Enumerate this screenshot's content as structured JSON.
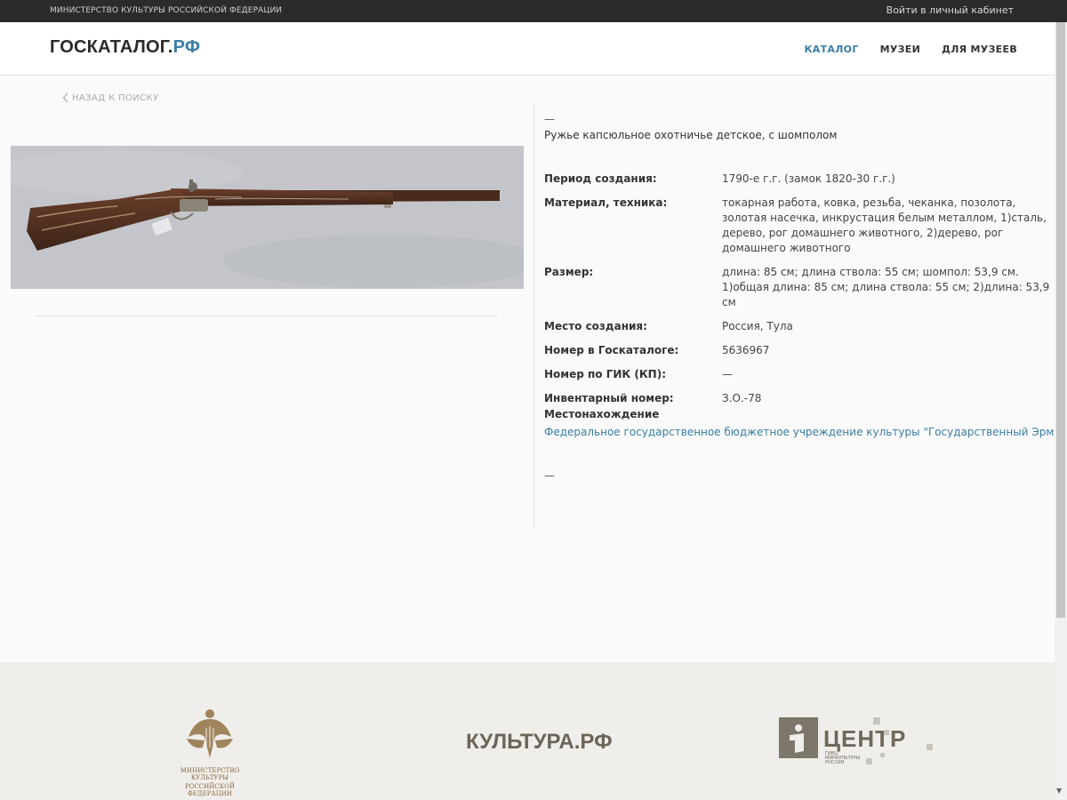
{
  "topbar": {
    "ministry": "МИНИСТЕРСТВО КУЛЬТУРЫ РОССИЙСКОЙ ФЕДЕРАЦИИ",
    "login": "Войти в личный кабинет"
  },
  "header": {
    "logo_main": "ГОСКАТАЛОГ.",
    "logo_accent": "РФ",
    "nav": [
      {
        "label": "КАТАЛОГ",
        "active": true
      },
      {
        "label": "МУЗЕИ",
        "active": false
      },
      {
        "label": "ДЛЯ МУЗЕЕВ",
        "active": false
      }
    ]
  },
  "back_link": "НАЗАД К ПОИСКУ",
  "item": {
    "dash_top": "—",
    "title": "Ружье капсюльное охотничье детское, с шомполом",
    "properties": [
      {
        "label": "Период создания:",
        "value": "1790-е г.г. (замок 1820-30 г.г.)"
      },
      {
        "label": "Материал, техника:",
        "value": "токарная работа, ковка, резьба, чеканка, позолота, золотая насечка, инкрустация белым металлом, 1)сталь, дерево, рог домашнего животного, 2)дерево, рог домашнего животного"
      },
      {
        "label": "Размер:",
        "value": "длина: 85 см; длина ствола: 55 см; шомпол: 53,9 см. 1)общая длина: 85 см; длина ствола: 55 см; 2)длина: 53,9 см"
      },
      {
        "label": "Место создания:",
        "value": "Россия, Тула"
      },
      {
        "label": "Номер в Госкаталоге:",
        "value": "5636967"
      },
      {
        "label": "Номер по ГИК (КП):",
        "value": "—"
      },
      {
        "label": "Инвентарный номер:",
        "value": "З.О.-78"
      }
    ],
    "location_label": "Местонахождение",
    "location_value": "Федеральное государственное бюджетное учреждение культуры \"Государственный Эрмитаж\"",
    "dash_bottom": "—"
  },
  "footer": {
    "ministry_caption_1": "МИНИСТЕРСТВО КУЛЬТУРЫ",
    "ministry_caption_2": "РОССИЙСКОЙ ФЕДЕРАЦИИ",
    "kultura": "КУЛЬТУРА.РФ",
    "centr": "ЦЕНТР",
    "centr_sub_1": "ГИВЦ",
    "centr_sub_2": "МИНКУЛЬТУРЫ",
    "centr_sub_3": "РОССИИ"
  },
  "colors": {
    "accent": "#3a7ea5",
    "topbar": "#2b2b2b",
    "footer_bg": "#f0eeea"
  },
  "icons": [
    "chevron-left-icon",
    "rifle-photo",
    "ministry-emblem-icon",
    "centr-logo-icon",
    "chevron-down-icon"
  ]
}
